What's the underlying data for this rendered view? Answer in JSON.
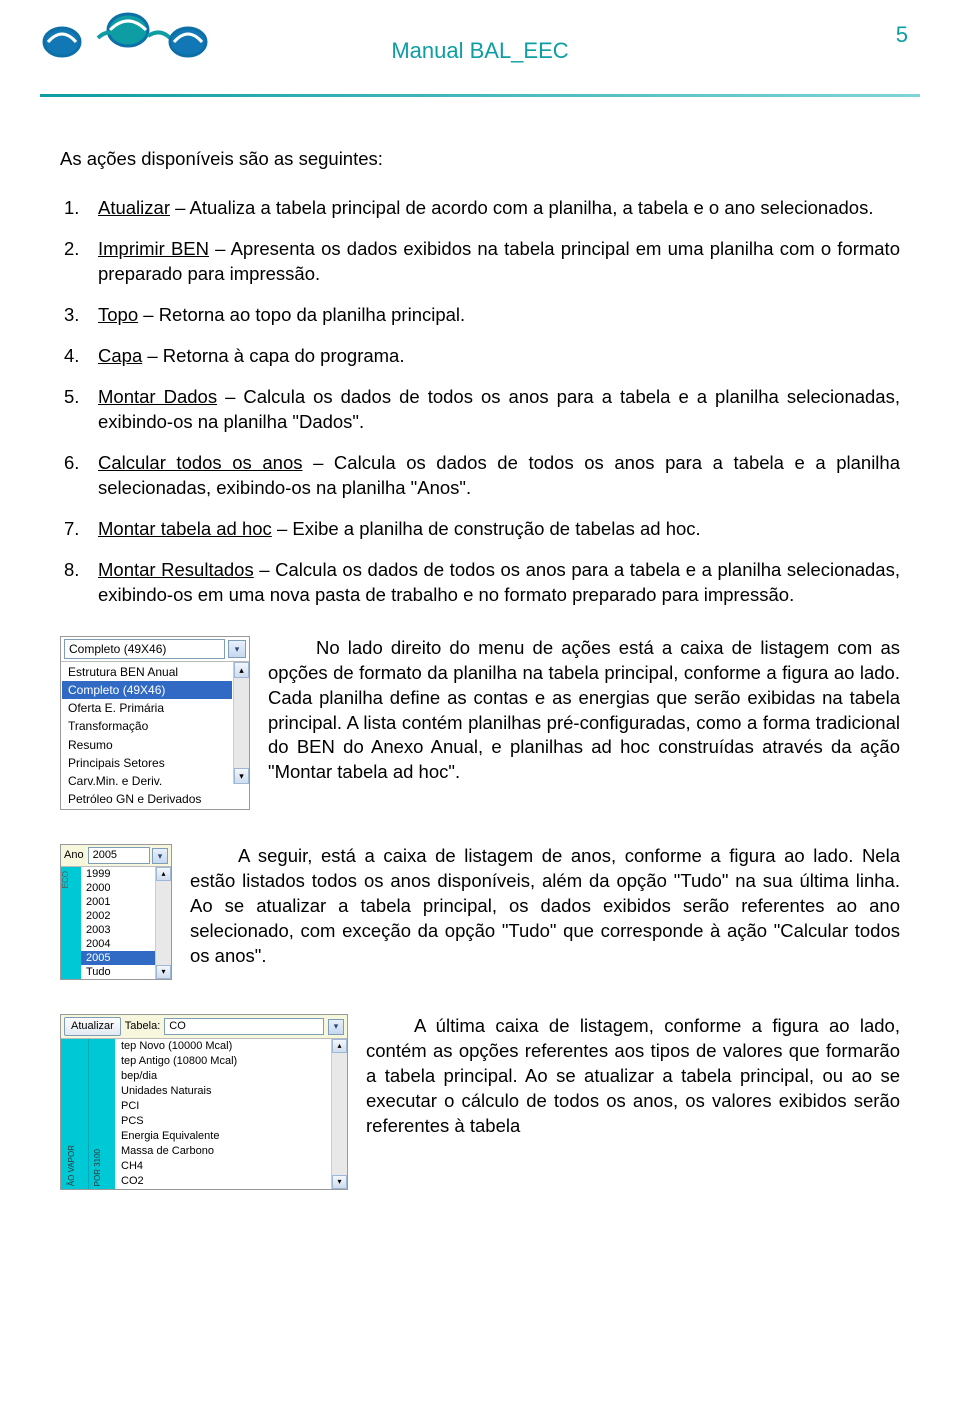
{
  "header": {
    "title": "Manual BAL_EEC",
    "page_number": "5"
  },
  "intro": "As ações disponíveis são as seguintes:",
  "actions": [
    {
      "name": "Atualizar",
      "text": " – Atualiza a tabela principal de acordo com a planilha, a tabela e o ano selecionados."
    },
    {
      "name": "Imprimir BEN",
      "text": " – Apresenta os dados exibidos na tabela principal em uma planilha com o formato preparado para impressão."
    },
    {
      "name": "Topo",
      "text": " – Retorna ao topo da planilha principal."
    },
    {
      "name": "Capa",
      "text": " – Retorna à capa do programa."
    },
    {
      "name": "Montar Dados",
      "text": " – Calcula os dados de todos os anos para a tabela e a planilha selecionadas, exibindo-os na planilha \"Dados\"."
    },
    {
      "name": "Calcular todos os anos",
      "text": " – Calcula os dados de todos os anos para a tabela e a planilha selecionadas, exibindo-os na planilha \"Anos\"."
    },
    {
      "name": "Montar tabela ad hoc",
      "text": " – Exibe a planilha de construção de tabelas ad hoc."
    },
    {
      "name": "Montar Resultados",
      "text": " – Calcula os dados de todos os anos para a tabela e a planilha selecionadas, exibindo-os em uma nova pasta de trabalho e no formato preparado para impressão."
    }
  ],
  "para_format": "No lado direito do menu de ações está a caixa de listagem com as opções de formato da planilha na tabela principal, conforme a figura ao lado. Cada planilha define as contas e as energias que serão exibidas na tabela principal. A lista contém planilhas pré-configuradas, como a forma tradicional do BEN do Anexo Anual, e planilhas ad hoc construídas através da ação \"Montar tabela ad hoc\".",
  "para_year": "A seguir, está a caixa de listagem de anos, conforme a figura ao lado. Nela estão listados todos os anos disponíveis, além da opção \"Tudo\" na sua última linha. Ao se atualizar a tabela principal, os dados exibidos serão referentes ao ano selecionado, com exceção da opção \"Tudo\" que corresponde à ação \"Calcular todos os anos\".",
  "para_tabela": "A última caixa de listagem, conforme a figura ao lado, contém as opções referentes aos tipos de valores que formarão a tabela principal. Ao se atualizar a tabela principal, ou ao se executar o cálculo de todos os anos, os valores exibidos serão referentes à tabela",
  "fig_format": {
    "selected": "Completo (49X46)",
    "items": [
      "Estrutura BEN Anual",
      "Completo (49X46)",
      "Oferta E. Primária",
      "Transformação",
      "Resumo",
      "Principais Setores",
      "Carv.Min. e Deriv.",
      "Petróleo GN e Derivados"
    ],
    "selected_index": 1
  },
  "fig_year": {
    "label": "Ano",
    "selected": "2005",
    "eco_label": "ECO",
    "items": [
      "1999",
      "2000",
      "2001",
      "2002",
      "2003",
      "2004",
      "2005",
      "Tudo"
    ],
    "selected_index": 6
  },
  "fig_tabela": {
    "button": "Atualizar",
    "label": "Tabela:",
    "selected": "CO",
    "side_label_1": "ÃO VAPOR",
    "side_label_2": "POR 3100",
    "items": [
      "tep Novo  (10000 Mcal)",
      "tep Antigo (10800 Mcal)",
      "bep/dia",
      "Unidades Naturais",
      "PCI",
      "PCS",
      "Energia Equivalente",
      "Massa de Carbono",
      "CH4",
      "CO2"
    ]
  }
}
